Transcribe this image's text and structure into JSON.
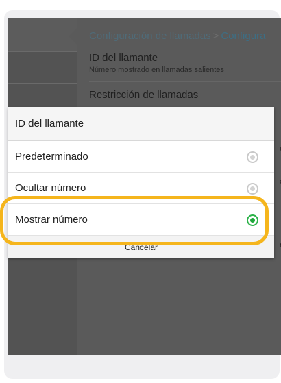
{
  "settings": {
    "breadcrumb": {
      "parent": "Configuración de llamadas",
      "separator": ">",
      "current": "Configura"
    },
    "items": [
      {
        "title": "ID del llamante",
        "subtitle": "Número mostrado en llamadas salientes"
      },
      {
        "title": "Restricción de llamadas"
      }
    ],
    "peek_text": [
      "e",
      "o",
      "n"
    ]
  },
  "dialog": {
    "title": "ID del llamante",
    "options": [
      {
        "label": "Predeterminado",
        "selected": false
      },
      {
        "label": "Ocultar número",
        "selected": false
      },
      {
        "label": "Mostrar número",
        "selected": true
      }
    ],
    "cancel_label": "Cancelar"
  },
  "colors": {
    "highlight": "#f5b51c",
    "radio_selected": "#1ea83a",
    "breadcrumb_current": "#3d6e84"
  }
}
